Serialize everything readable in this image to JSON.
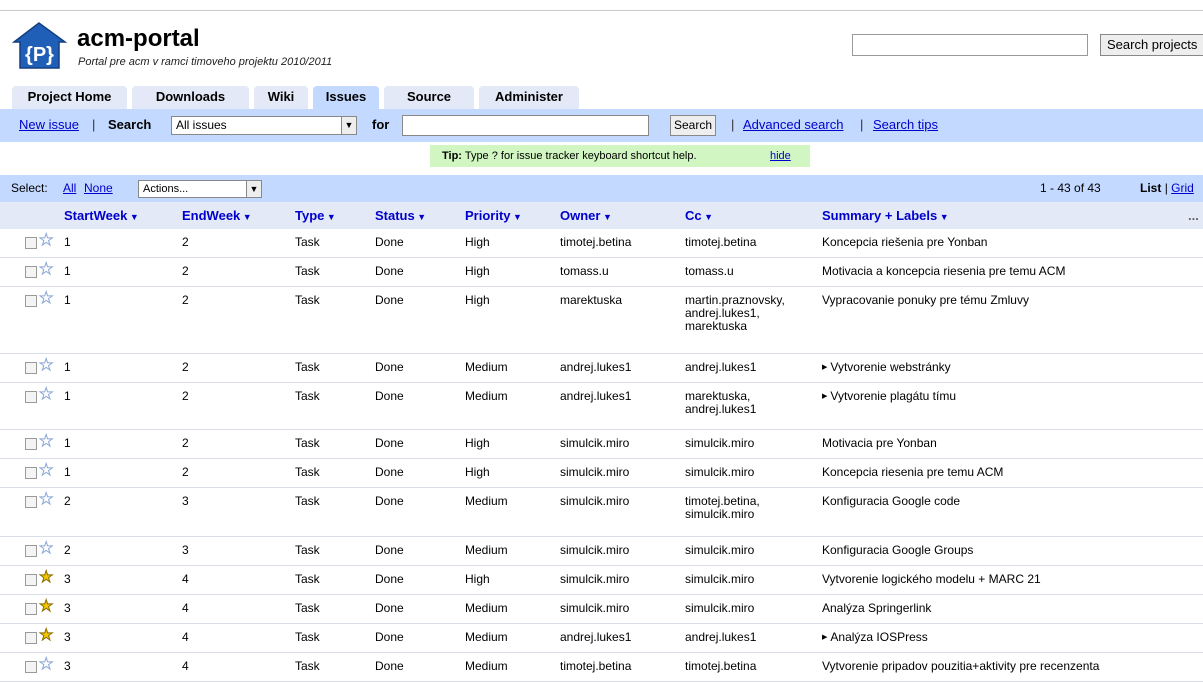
{
  "project": {
    "logo_text": "{P}",
    "name": "acm-portal",
    "subtitle": "Portal pre acm v ramci timoveho projektu 2010/2011"
  },
  "header_search": {
    "button_label": "Search projects",
    "value": ""
  },
  "tabs": [
    {
      "label": "Project Home",
      "active": false
    },
    {
      "label": "Downloads",
      "active": false
    },
    {
      "label": "Wiki",
      "active": false
    },
    {
      "label": "Issues",
      "active": true
    },
    {
      "label": "Source",
      "active": false
    },
    {
      "label": "Administer",
      "active": false
    }
  ],
  "toolbar": {
    "new_issue": "New issue",
    "sep": "|",
    "search_label": "Search",
    "scope_selected": "All issues",
    "for_label": "for",
    "for_value": "",
    "search_button": "Search",
    "advanced_search": "Advanced search",
    "search_tips": "Search tips"
  },
  "tip": {
    "label": "Tip:",
    "text": "Type ? for issue tracker keyboard shortcut help.",
    "hide": "hide"
  },
  "select_bar": {
    "select_label": "Select:",
    "all": "All",
    "none": "None",
    "actions": "Actions...",
    "pager": "1 - 43 of 43",
    "list": "List",
    "view_sep": "|",
    "grid": "Grid"
  },
  "icons": {
    "dropdown": "dropdown-arrow-icon",
    "star": "star-icon",
    "checkbox": "checkbox-icon",
    "expand": "expand-triangle-icon",
    "more": "more-columns-icon"
  },
  "colors": {
    "toolbar_bg": "#c3d9ff",
    "header_bg": "#e3e9f7",
    "tip_bg": "#d1f6c2",
    "link": "#0000cc",
    "star_on": "#f2c500"
  },
  "columns": [
    "StartWeek",
    "EndWeek",
    "Type",
    "Status",
    "Priority",
    "Owner",
    "Cc",
    "Summary + Labels"
  ],
  "more_columns": "...",
  "rows": [
    {
      "starred": false,
      "start": "1",
      "end": "2",
      "type": "Task",
      "status": "Done",
      "priority": "High",
      "owner": "timotej.betina",
      "cc": [
        "timotej.betina"
      ],
      "summary": "Koncepcia riešenia pre Yonban",
      "has_labels": false
    },
    {
      "starred": false,
      "start": "1",
      "end": "2",
      "type": "Task",
      "status": "Done",
      "priority": "High",
      "owner": "tomass.u",
      "cc": [
        "tomass.u"
      ],
      "summary": "Motivacia a koncepcia riesenia pre temu ACM",
      "has_labels": false
    },
    {
      "starred": false,
      "start": "1",
      "end": "2",
      "type": "Task",
      "status": "Done",
      "priority": "High",
      "owner": "marektuska",
      "cc": [
        "martin.praznovsky,",
        "andrej.lukes1,",
        "marektuska"
      ],
      "summary": "Vypracovanie ponuky pre tému Zmluvy",
      "has_labels": false
    },
    {
      "starred": false,
      "start": "1",
      "end": "2",
      "type": "Task",
      "status": "Done",
      "priority": "Medium",
      "owner": "andrej.lukes1",
      "cc": [
        "andrej.lukes1"
      ],
      "summary": "Vytvorenie webstránky",
      "has_labels": true
    },
    {
      "starred": false,
      "start": "1",
      "end": "2",
      "type": "Task",
      "status": "Done",
      "priority": "Medium",
      "owner": "andrej.lukes1",
      "cc": [
        "marektuska,",
        "andrej.lukes1"
      ],
      "summary": "Vytvorenie plagátu tímu",
      "has_labels": true
    },
    {
      "starred": false,
      "start": "1",
      "end": "2",
      "type": "Task",
      "status": "Done",
      "priority": "High",
      "owner": "simulcik.miro",
      "cc": [
        "simulcik.miro"
      ],
      "summary": "Motivacia pre Yonban",
      "has_labels": false
    },
    {
      "starred": false,
      "start": "1",
      "end": "2",
      "type": "Task",
      "status": "Done",
      "priority": "High",
      "owner": "simulcik.miro",
      "cc": [
        "simulcik.miro"
      ],
      "summary": "Koncepcia riesenia pre temu ACM",
      "has_labels": false
    },
    {
      "starred": false,
      "start": "2",
      "end": "3",
      "type": "Task",
      "status": "Done",
      "priority": "Medium",
      "owner": "simulcik.miro",
      "cc": [
        "timotej.betina,",
        "simulcik.miro"
      ],
      "summary": "Konfiguracia Google code",
      "has_labels": false
    },
    {
      "starred": false,
      "start": "2",
      "end": "3",
      "type": "Task",
      "status": "Done",
      "priority": "Medium",
      "owner": "simulcik.miro",
      "cc": [
        "simulcik.miro"
      ],
      "summary": "Konfiguracia Google Groups",
      "has_labels": false
    },
    {
      "starred": true,
      "start": "3",
      "end": "4",
      "type": "Task",
      "status": "Done",
      "priority": "High",
      "owner": "simulcik.miro",
      "cc": [
        "simulcik.miro"
      ],
      "summary": "Vytvorenie logického modelu + MARC 21",
      "has_labels": false
    },
    {
      "starred": true,
      "start": "3",
      "end": "4",
      "type": "Task",
      "status": "Done",
      "priority": "Medium",
      "owner": "simulcik.miro",
      "cc": [
        "simulcik.miro"
      ],
      "summary": "Analýza Springerlink",
      "has_labels": false
    },
    {
      "starred": true,
      "start": "3",
      "end": "4",
      "type": "Task",
      "status": "Done",
      "priority": "Medium",
      "owner": "andrej.lukes1",
      "cc": [
        "andrej.lukes1"
      ],
      "summary": "Analýza IOSPress",
      "has_labels": true
    },
    {
      "starred": false,
      "start": "3",
      "end": "4",
      "type": "Task",
      "status": "Done",
      "priority": "Medium",
      "owner": "timotej.betina",
      "cc": [
        "timotej.betina"
      ],
      "summary": "Vytvorenie pripadov pouzitia+aktivity pre recenzenta",
      "has_labels": false
    }
  ]
}
